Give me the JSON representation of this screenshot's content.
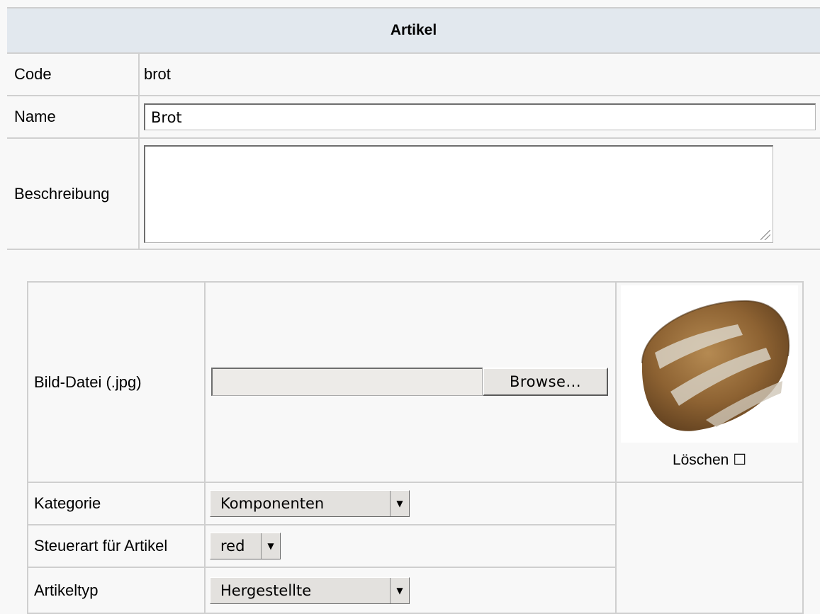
{
  "artikel": {
    "header": "Artikel",
    "code_label": "Code",
    "code_value": "brot",
    "name_label": "Name",
    "name_value": "Brot",
    "beschreibung_label": "Beschreibung",
    "beschreibung_value": ""
  },
  "bild": {
    "label": "Bild-Datei (.jpg)",
    "browse_label": "Browse...",
    "file_value": "",
    "delete_label": "Löschen",
    "delete_checked": false
  },
  "kategorie": {
    "label": "Kategorie",
    "selected": "Komponenten"
  },
  "steuerart": {
    "label": "Steuerart für Artikel",
    "selected": "red"
  },
  "artikeltyp": {
    "label": "Artikeltyp",
    "selected": "Hergestellte"
  },
  "icons": {
    "dropdown": "triangle-down-icon",
    "checkbox": "checkbox-unchecked-icon",
    "image": "bread-image"
  }
}
